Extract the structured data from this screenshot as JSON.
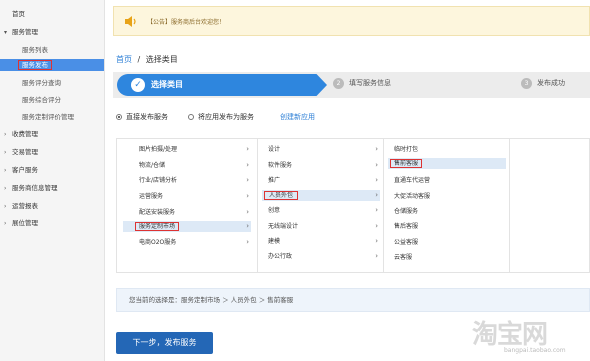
{
  "sidebar": {
    "home": "首页",
    "service_mgmt": "服务管理",
    "sub": [
      "服务列表",
      "服务发布",
      "服务评分查询",
      "服务综合评分",
      "服务定制评价管理"
    ],
    "others": [
      "收费管理",
      "交易管理",
      "客户服务",
      "服务商信息管理",
      "运营报表",
      "展位管理"
    ]
  },
  "notice": {
    "text": "【公告】服务商后台欢迎您！"
  },
  "breadcrumb": {
    "home": "首页",
    "sep": "/",
    "current": "选择类目"
  },
  "steps": {
    "s1": "选择类目",
    "s2_num": "2",
    "s2": "填写服务信息",
    "s3_num": "3",
    "s3": "发布成功"
  },
  "publish": {
    "direct": "直接发布服务",
    "app": "将应用发布为服务",
    "create_link": "创建新应用"
  },
  "categories": {
    "col1": [
      "图片拍摄/处理",
      "物流/仓储",
      "行业/店铺分析",
      "运营服务",
      "配送安装服务",
      "服务定制市场",
      "电商O2O服务"
    ],
    "col2": [
      "设计",
      "软件服务",
      "推广",
      "人员外包",
      "创意",
      "无线端设计",
      "建模",
      "办公行政"
    ],
    "col3": [
      "临时打包",
      "售前客服",
      "直通车代运营",
      "大促活动客服",
      "仓储服务",
      "售后客服",
      "公益客服",
      "云客服"
    ]
  },
  "selection": {
    "text": "您当前的选择是：服务定制市场 ＞ 人员外包 ＞ 售前客服"
  },
  "next_button": "下一步，发布服务",
  "watermark": {
    "big": "淘宝网",
    "small": "bangpai.taobao.com"
  }
}
